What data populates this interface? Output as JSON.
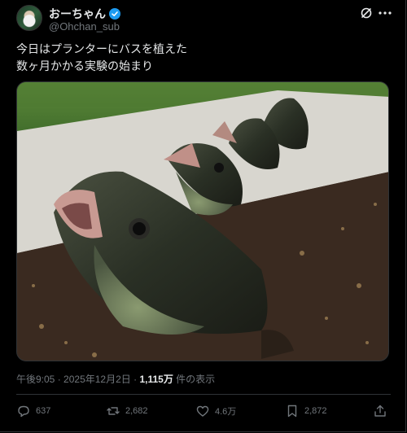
{
  "author": {
    "display_name": "おーちゃん",
    "handle": "@Ohchan_sub",
    "verified": true
  },
  "post": {
    "text": "今日はプランターにバスを植えた\n数ヶ月かかる実験の始まり",
    "media_alt": "fish heads in soil planter",
    "time": "午後9:05",
    "separator": "·",
    "date": "2025年12月2日",
    "views_count": "1,115万",
    "views_label": "件の表示"
  },
  "actions": {
    "replies": "637",
    "reposts": "2,682",
    "likes": "4.6万",
    "bookmarks": "2,872"
  },
  "icons": [
    "verified-badge-icon",
    "grok-icon",
    "more-icon",
    "reply-icon",
    "repost-icon",
    "like-icon",
    "bookmark-icon",
    "share-icon"
  ],
  "colors": {
    "background": "#000000",
    "text": "#e7e9ea",
    "secondary": "#71767b",
    "verified": "#1d9bf0"
  }
}
